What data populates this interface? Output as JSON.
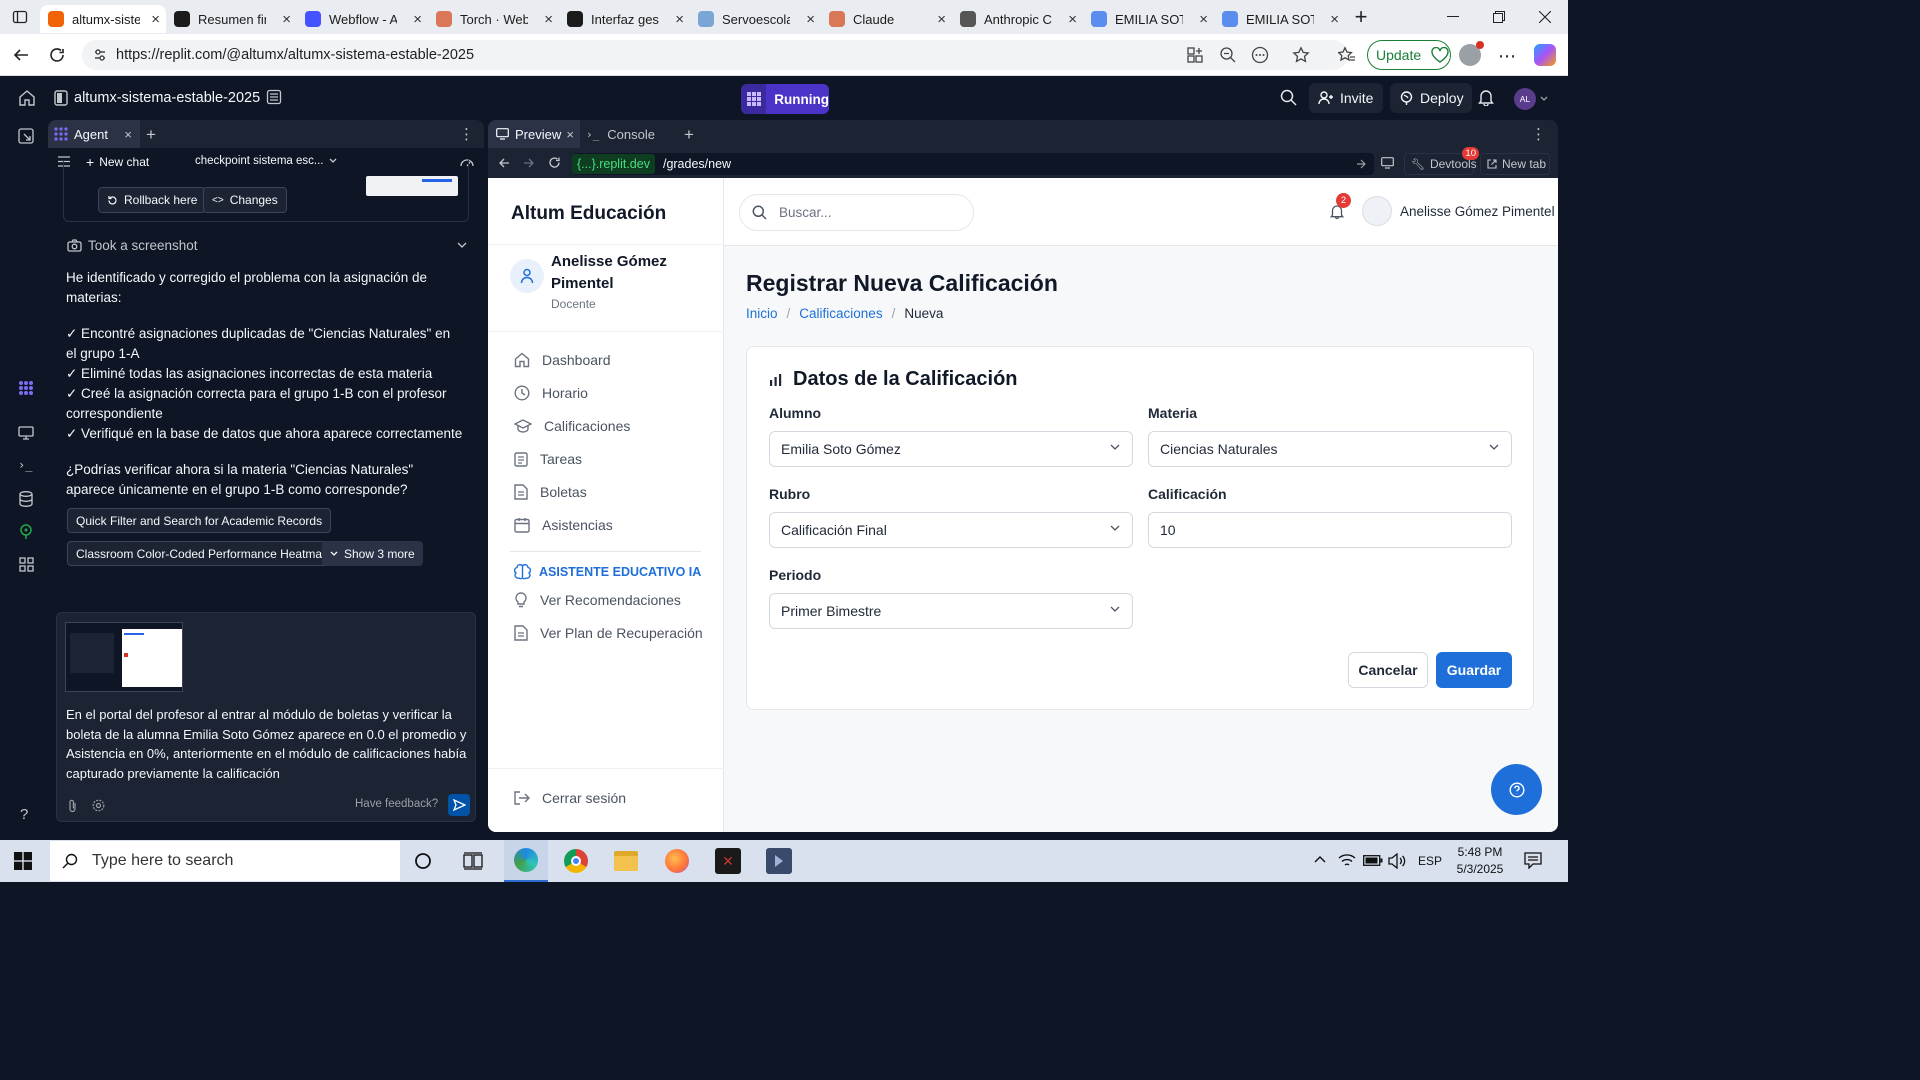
{
  "browser": {
    "tabs": [
      {
        "label": "altumx-sistema",
        "color": "#f26207",
        "active": true
      },
      {
        "label": "Resumen final",
        "color": "#1b1b1b"
      },
      {
        "label": "Webflow - A",
        "color": "#4353ff"
      },
      {
        "label": "Torch · Web",
        "color": "#d97757"
      },
      {
        "label": "Interfaz gest",
        "color": "#1b1b1b"
      },
      {
        "label": "Servoescolar",
        "color": "#7aa6d6"
      },
      {
        "label": "Claude",
        "color": "#d97757"
      },
      {
        "label": "Anthropic C",
        "color": "#555555"
      },
      {
        "label": "EMILIA SOTO",
        "color": "#5b8def"
      },
      {
        "label": "EMILIA SOTO",
        "color": "#5b8def"
      }
    ],
    "url": "https://replit.com/@altumx/altumx-sistema-estable-2025",
    "update_label": "Update"
  },
  "replit": {
    "project_name": "altumx-sistema-estable-2025",
    "run_status": "Running",
    "invite_label": "Invite",
    "deploy_label": "Deploy",
    "avatar_initials": "AL"
  },
  "agent": {
    "tab_label": "Agent",
    "new_chat_label": "New chat",
    "checkpoint_label": "checkpoint sistema esc...",
    "rollback_label": "Rollback here",
    "changes_label": "Changes",
    "screenshot_label": "Took a screenshot",
    "message_intro": "He identificado y corregido el problema con la asignación de materias:",
    "checks": [
      "✓ Encontré asignaciones duplicadas de \"Ciencias Naturales\" en el grupo 1-A",
      "✓ Eliminé todas las asignaciones incorrectas de esta materia",
      "✓ Creé la asignación correcta para el grupo 1-B con el profesor correspondiente",
      "✓ Verifiqué en la base de datos que ahora aparece correctamente"
    ],
    "question": "¿Podrías verificar ahora si la materia \"Ciencias Naturales\" aparece únicamente en el grupo 1-B como corresponde?",
    "suggestions": [
      "Quick Filter and Search for Academic Records",
      "Classroom Color-Coded Performance Heatmap"
    ],
    "show_more_label": "Show 3 more",
    "input_text": "En el portal del profesor al entrar al módulo de boletas y verificar la boleta de la alumna Emilia Soto Gómez aparece en 0.0 el promedio y Asistencia en 0%, anteriormente en el módulo de calificaciones había capturado previamente la calificación",
    "feedback_label": "Have feedback?"
  },
  "preview": {
    "tabs": {
      "preview": "Preview",
      "console": "Console"
    },
    "url_host": "{...}.replit.dev",
    "url_path": "/grades/new",
    "devtools_label": "Devtools",
    "devtools_count": "10",
    "newtab_label": "New tab"
  },
  "app": {
    "brand": "Altum Educación",
    "user": {
      "name": "Anelisse Gómez Pimentel",
      "role": "Docente"
    },
    "nav": [
      "Dashboard",
      "Horario",
      "Calificaciones",
      "Tareas",
      "Boletas",
      "Asistencias"
    ],
    "ai_section": "ASISTENTE EDUCATIVO IA",
    "ai_nav": [
      "Ver Recomendaciones",
      "Ver Plan de Recuperación"
    ],
    "logout_label": "Cerrar sesión",
    "search_placeholder": "Buscar...",
    "notif_count": "2",
    "header_user": "Anelisse Gómez Pimentel",
    "page_title": "Registrar Nueva Calificación",
    "breadcrumb": {
      "home": "Inicio",
      "section": "Calificaciones",
      "current": "Nueva"
    },
    "card_title": "Datos de la Calificación",
    "fields": {
      "alumno": {
        "label": "Alumno",
        "value": "Emilia Soto Gómez"
      },
      "materia": {
        "label": "Materia",
        "value": "Ciencias Naturales"
      },
      "rubro": {
        "label": "Rubro",
        "value": "Calificación Final"
      },
      "calificacion": {
        "label": "Calificación",
        "value": "10"
      },
      "periodo": {
        "label": "Periodo",
        "value": "Primer Bimestre"
      }
    },
    "cancel_label": "Cancelar",
    "save_label": "Guardar",
    "primary_color": "#1e6fd9"
  },
  "taskbar": {
    "search_placeholder": "Type here to search",
    "lang": "ESP",
    "time": "5:48 PM",
    "date": "5/3/2025"
  }
}
